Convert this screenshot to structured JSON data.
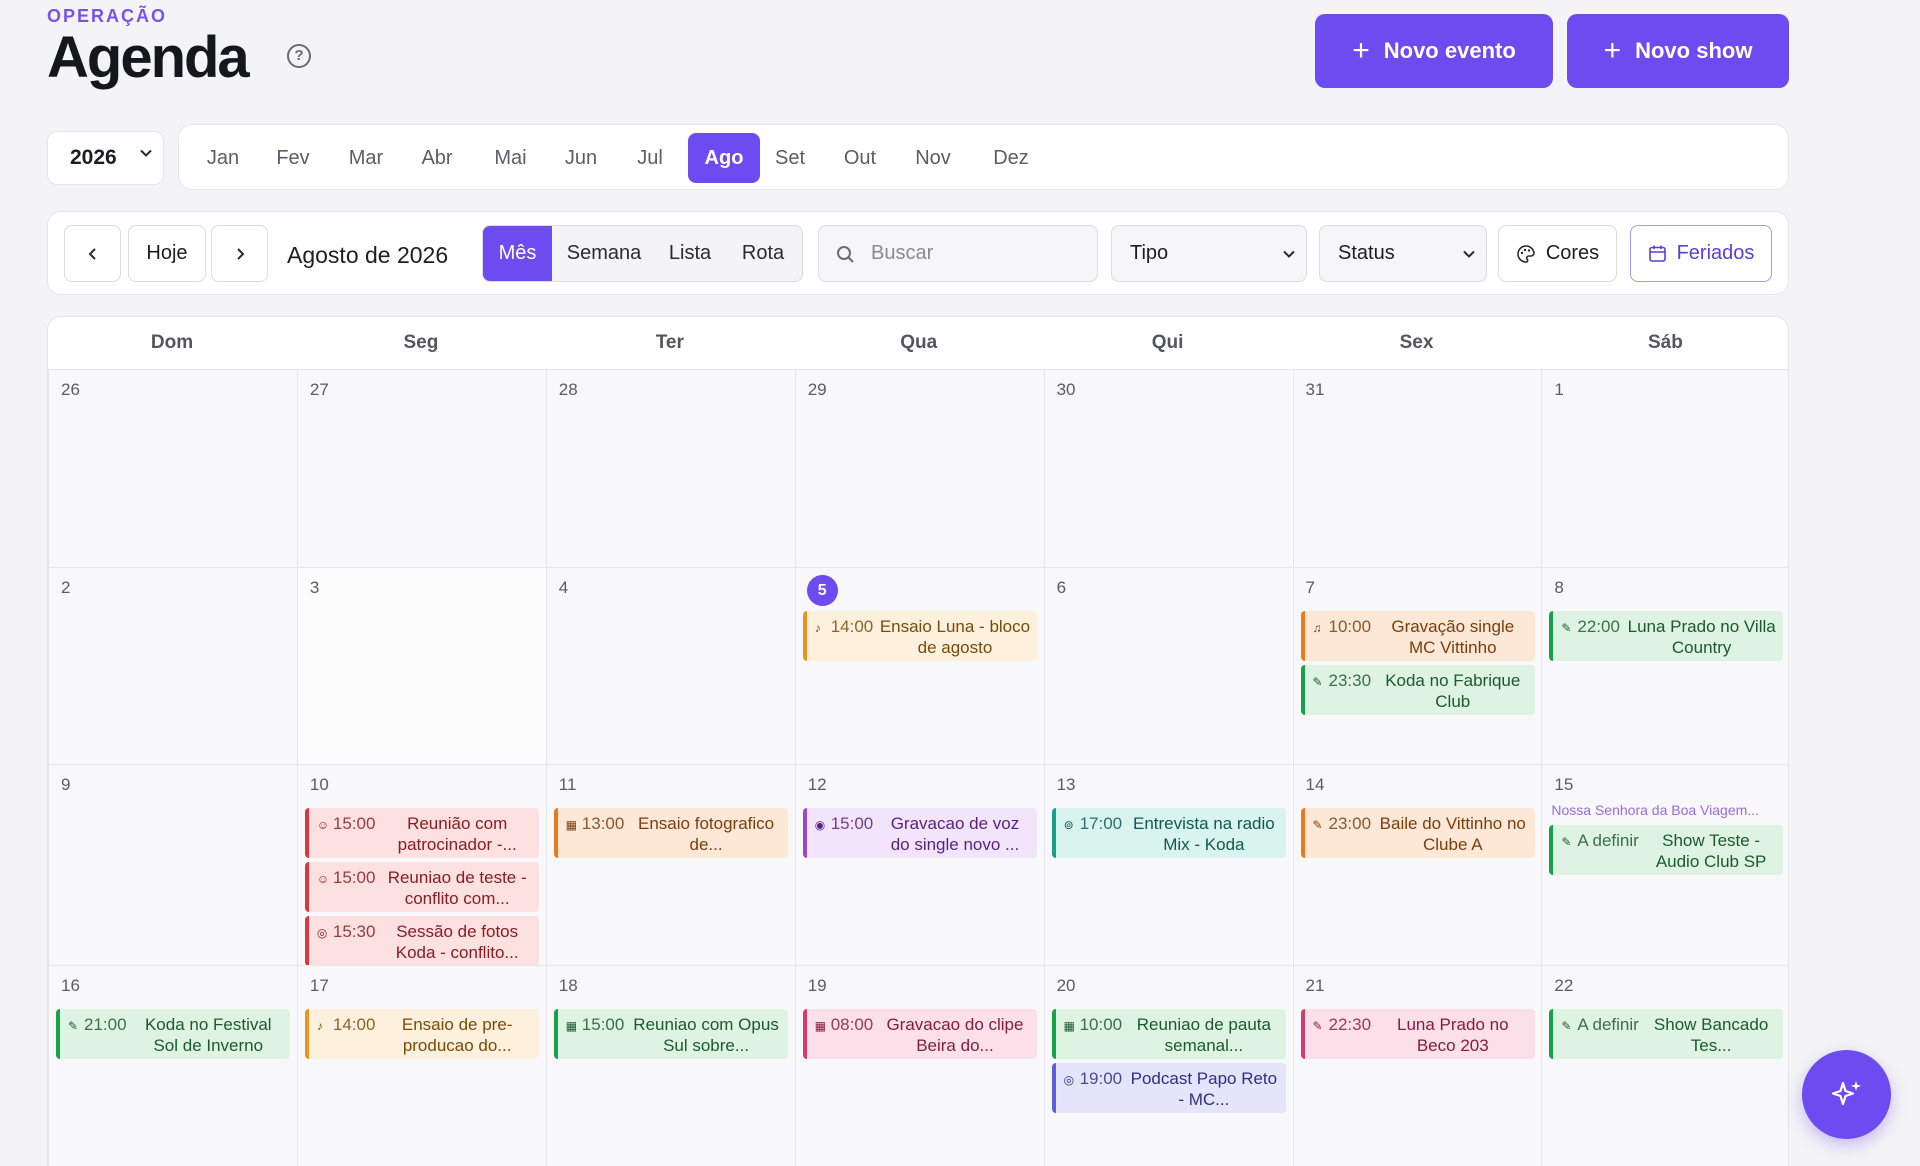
{
  "header": {
    "eyebrow": "OPERAÇÃO",
    "title": "Agenda",
    "help_icon": "?",
    "new_event": "Novo evento",
    "new_show": "Novo show",
    "plus": "+"
  },
  "year_select": {
    "value": "2026"
  },
  "months": [
    "Jan",
    "Fev",
    "Mar",
    "Abr",
    "Mai",
    "Jun",
    "Jul",
    "Ago",
    "Set",
    "Out",
    "Nov",
    "Dez"
  ],
  "active_month": "Ago",
  "toolbar": {
    "prev": "‹",
    "today": "Hoje",
    "next": "›",
    "period": "Agosto de 2026",
    "views": [
      "Mês",
      "Semana",
      "Lista",
      "Rota"
    ],
    "active_view": "Mês",
    "search_placeholder": "Buscar",
    "type_filter": "Tipo",
    "status_filter": "Status",
    "colors": "Cores",
    "holidays": "Feriados"
  },
  "weekdays": [
    "Dom",
    "Seg",
    "Ter",
    "Qua",
    "Qui",
    "Sex",
    "Sáb"
  ],
  "weeks": [
    [
      "26",
      "27",
      "28",
      "29",
      "30",
      "31",
      "1"
    ],
    [
      "2",
      "3",
      "4",
      "5",
      "6",
      "7",
      "8"
    ],
    [
      "9",
      "10",
      "11",
      "12",
      "13",
      "14",
      "15"
    ],
    [
      "16",
      "17",
      "18",
      "19",
      "20",
      "21",
      "22"
    ]
  ],
  "today_day": "5",
  "holiday_label": "Nossa Senhora da Boa Viagem...",
  "events": {
    "w1d3": [
      {
        "time": "14:00",
        "title": "Ensaio Luna - bloco de agosto",
        "color": "amber",
        "icon": "guitar"
      }
    ],
    "w1d5": [
      {
        "time": "10:00",
        "title": "Gravação single MC Vittinho",
        "color": "orange",
        "icon": "music"
      },
      {
        "time": "23:30",
        "title": "Koda no Fabrique Club",
        "color": "green",
        "icon": "mic"
      }
    ],
    "w1d6": [
      {
        "time": "22:00",
        "title": "Luna Prado no Villa Country",
        "color": "green",
        "icon": "mic"
      }
    ],
    "w2d1": [
      {
        "time": "15:00",
        "title": "Reunião com patrocinador -...",
        "color": "red",
        "icon": "users"
      },
      {
        "time": "15:00",
        "title": "Reuniao de teste - conflito com...",
        "color": "red",
        "icon": "users"
      },
      {
        "time": "15:30",
        "title": "Sessão de fotos Koda - conflito...",
        "color": "red",
        "icon": "camera"
      }
    ],
    "w2d2": [
      {
        "time": "13:00",
        "title": "Ensaio fotografico de...",
        "color": "orange",
        "icon": "calendar"
      }
    ],
    "w2d3": [
      {
        "time": "15:00",
        "title": "Gravacao de voz do single novo ...",
        "color": "purple",
        "icon": "disc"
      }
    ],
    "w2d4": [
      {
        "time": "17:00",
        "title": "Entrevista na radio Mix - Koda",
        "color": "teal",
        "icon": "radio"
      }
    ],
    "w2d5": [
      {
        "time": "23:00",
        "title": "Baile do Vittinho no Clube A",
        "color": "orange",
        "icon": "mic"
      }
    ],
    "w2d6": [
      {
        "time": "A definir",
        "title": "Show Teste - Audio Club SP",
        "color": "green",
        "icon": "mic"
      }
    ],
    "w3d0": [
      {
        "time": "21:00",
        "title": "Koda no Festival Sol de Inverno",
        "color": "green",
        "icon": "mic"
      }
    ],
    "w3d1": [
      {
        "time": "14:00",
        "title": "Ensaio de pre-producao do...",
        "color": "amber",
        "icon": "guitar"
      }
    ],
    "w3d2": [
      {
        "time": "15:00",
        "title": "Reuniao com Opus Sul sobre...",
        "color": "green",
        "icon": "calendar"
      }
    ],
    "w3d3": [
      {
        "time": "08:00",
        "title": "Gravacao do clipe Beira do...",
        "color": "pink",
        "icon": "calendar"
      }
    ],
    "w3d4": [
      {
        "time": "10:00",
        "title": "Reuniao de pauta semanal...",
        "color": "green",
        "icon": "calendar"
      },
      {
        "time": "19:00",
        "title": "Podcast Papo Reto - MC...",
        "color": "indigo",
        "icon": "podcast"
      }
    ],
    "w3d5": [
      {
        "time": "22:30",
        "title": "Luna Prado no Beco 203",
        "color": "pink",
        "icon": "mic"
      }
    ],
    "w3d6": [
      {
        "time": "A definir",
        "title": "Show Bancado Tes...",
        "color": "green",
        "icon": "mic"
      }
    ]
  },
  "fab_icon": "sparkles-icon"
}
